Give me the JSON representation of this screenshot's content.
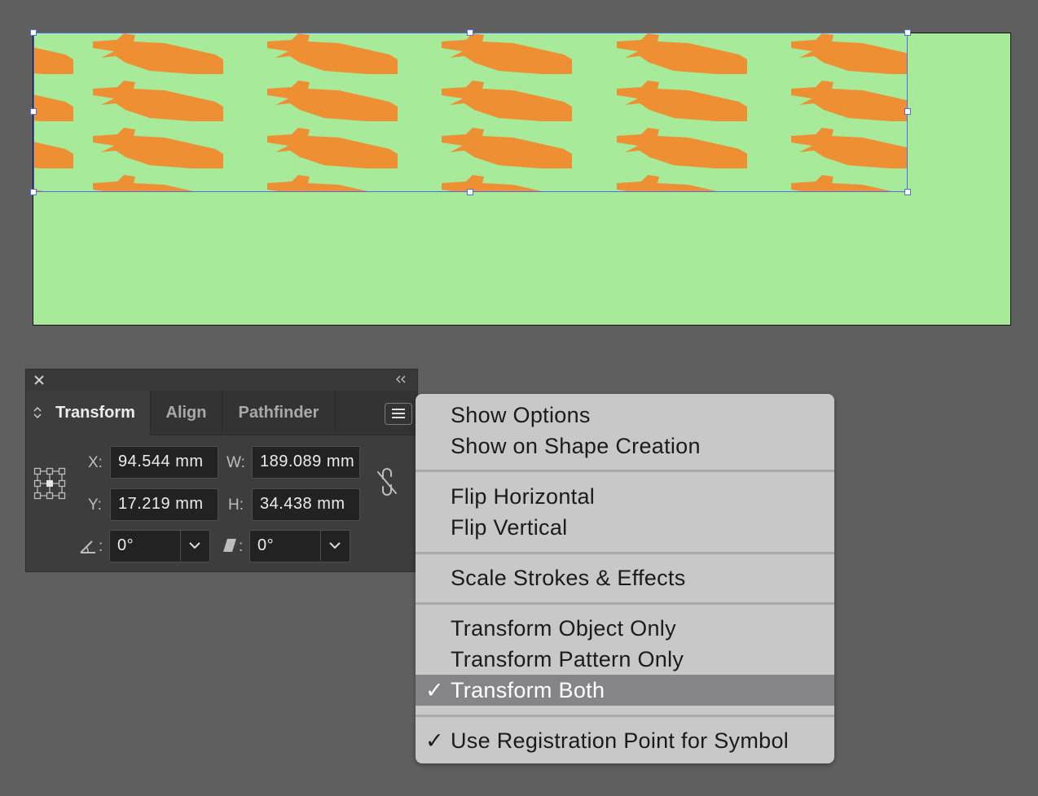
{
  "canvas": {
    "artboard_color": "#a6ea9a",
    "pattern_fill_color": "#ef8f33",
    "selection_color": "#4d6ee8"
  },
  "panel": {
    "tabs": [
      {
        "label": "Transform",
        "active": true
      },
      {
        "label": "Align",
        "active": false
      },
      {
        "label": "Pathfinder",
        "active": false
      }
    ],
    "fields": {
      "x_label": "X:",
      "x_value": "94.544 mm",
      "y_label": "Y:",
      "y_value": "17.219 mm",
      "w_label": "W:",
      "w_value": "189.089 mm",
      "h_label": "H:",
      "h_value": "34.438 mm",
      "angle_label": ":",
      "angle_value": "0°",
      "shear_label": ":",
      "shear_value": "0°"
    }
  },
  "menu": {
    "items": [
      {
        "label": "Show Options",
        "checked": false
      },
      {
        "label": "Show on Shape Creation",
        "checked": false
      },
      {
        "label": "Flip Horizontal",
        "checked": false
      },
      {
        "label": "Flip Vertical",
        "checked": false
      },
      {
        "label": "Scale Strokes & Effects",
        "checked": false
      },
      {
        "label": "Transform Object Only",
        "checked": false
      },
      {
        "label": "Transform Pattern Only",
        "checked": false
      },
      {
        "label": "Transform Both",
        "checked": true,
        "highlighted": true
      },
      {
        "label": "Use Registration Point for Symbol",
        "checked": true
      }
    ],
    "check_glyph": "✓"
  }
}
